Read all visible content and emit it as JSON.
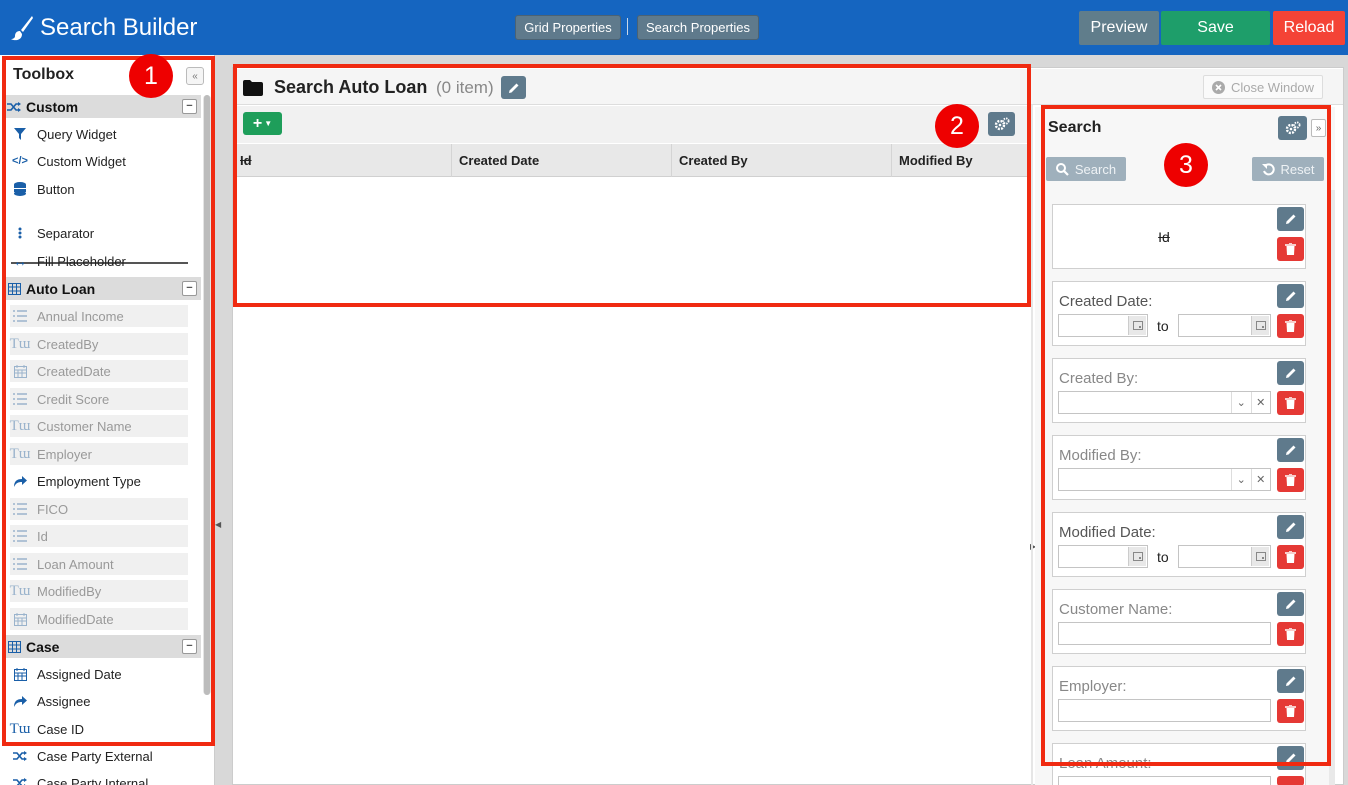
{
  "header": {
    "app_title": "Search Builder",
    "grid_properties": "Grid Properties",
    "search_properties": "Search Properties",
    "preview": "Preview",
    "save": "Save",
    "reload": "Reload"
  },
  "toolbox": {
    "title": "Toolbox",
    "sections": [
      {
        "name": "Custom",
        "icon": "shuffle-icon",
        "items": [
          {
            "label": "Query Widget",
            "icon": "filter-icon",
            "enabled": true
          },
          {
            "label": "Custom Widget",
            "icon": "code-icon",
            "enabled": true
          },
          {
            "label": "Button",
            "icon": "database-icon",
            "enabled": true
          },
          {
            "label": "Separator",
            "icon": "vertical-ellipsis-icon",
            "enabled": true
          },
          {
            "label": "Fill Placeholder",
            "icon": "horizontal-arrows-icon",
            "enabled": true
          }
        ]
      },
      {
        "name": "Auto Loan",
        "icon": "table-icon",
        "items": [
          {
            "label": "Annual Income",
            "icon": "list-icon",
            "enabled": false
          },
          {
            "label": "CreatedBy",
            "icon": "text-icon",
            "enabled": false
          },
          {
            "label": "CreatedDate",
            "icon": "calendar-icon",
            "enabled": false
          },
          {
            "label": "Credit Score",
            "icon": "list-icon",
            "enabled": false
          },
          {
            "label": "Customer Name",
            "icon": "text-icon",
            "enabled": false
          },
          {
            "label": "Employer",
            "icon": "text-icon",
            "enabled": false
          },
          {
            "label": "Employment Type",
            "icon": "share-arrow-icon",
            "enabled": true
          },
          {
            "label": "FICO",
            "icon": "list-icon",
            "enabled": false
          },
          {
            "label": "Id",
            "icon": "list-icon",
            "enabled": false
          },
          {
            "label": "Loan Amount",
            "icon": "list-icon",
            "enabled": false
          },
          {
            "label": "ModifiedBy",
            "icon": "text-icon",
            "enabled": false
          },
          {
            "label": "ModifiedDate",
            "icon": "calendar-icon",
            "enabled": false
          }
        ]
      },
      {
        "name": "Case",
        "icon": "table-icon",
        "items": [
          {
            "label": "Assigned Date",
            "icon": "calendar-icon",
            "enabled": true
          },
          {
            "label": "Assignee",
            "icon": "share-arrow-icon",
            "enabled": true
          },
          {
            "label": "Case ID",
            "icon": "text-icon",
            "enabled": true
          },
          {
            "label": "Case Party External",
            "icon": "shuffle-icon",
            "enabled": true
          },
          {
            "label": "Case Party Internal",
            "icon": "shuffle-icon",
            "enabled": true
          }
        ]
      }
    ]
  },
  "grid": {
    "title": "Search Auto Loan",
    "count": "(0 item)",
    "close_window": "Close Window",
    "columns": [
      "Id",
      "Created Date",
      "Created By",
      "Modified By"
    ]
  },
  "search_panel": {
    "title": "Search",
    "search_button": "Search",
    "reset_button": "Reset",
    "to_label": "to",
    "fields": [
      {
        "label": "Id",
        "type": "id"
      },
      {
        "label": "Created Date:",
        "type": "date-range"
      },
      {
        "label": "Created By:",
        "type": "select"
      },
      {
        "label": "Modified By:",
        "type": "select"
      },
      {
        "label": "Modified Date:",
        "type": "date-range"
      },
      {
        "label": "Customer Name:",
        "type": "text"
      },
      {
        "label": "Employer:",
        "type": "text"
      },
      {
        "label": "Loan Amount:",
        "type": "text"
      }
    ]
  },
  "annotations": [
    "1",
    "2",
    "3"
  ],
  "colors": {
    "header_bg": "#1565c0",
    "save": "#1e9e6a",
    "reload": "#f44336",
    "preview": "#607d8b",
    "annotation": "#f02a11"
  }
}
